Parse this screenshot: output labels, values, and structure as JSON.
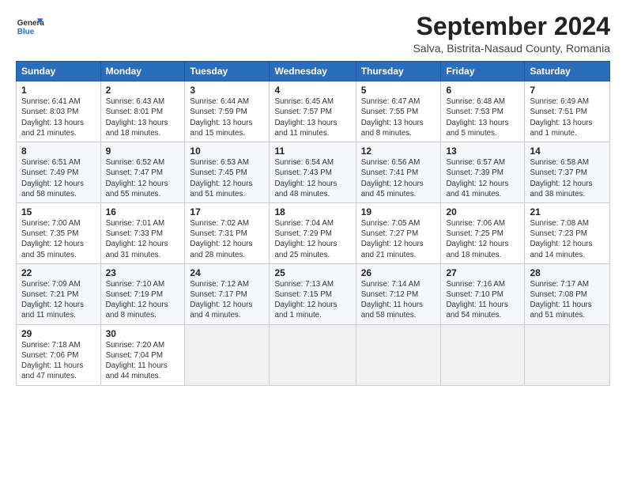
{
  "header": {
    "logo_line1": "General",
    "logo_line2": "Blue",
    "month_title": "September 2024",
    "subtitle": "Salva, Bistrita-Nasaud County, Romania"
  },
  "weekdays": [
    "Sunday",
    "Monday",
    "Tuesday",
    "Wednesday",
    "Thursday",
    "Friday",
    "Saturday"
  ],
  "weeks": [
    [
      {
        "day": "1",
        "info": "Sunrise: 6:41 AM\nSunset: 8:03 PM\nDaylight: 13 hours\nand 21 minutes."
      },
      {
        "day": "2",
        "info": "Sunrise: 6:43 AM\nSunset: 8:01 PM\nDaylight: 13 hours\nand 18 minutes."
      },
      {
        "day": "3",
        "info": "Sunrise: 6:44 AM\nSunset: 7:59 PM\nDaylight: 13 hours\nand 15 minutes."
      },
      {
        "day": "4",
        "info": "Sunrise: 6:45 AM\nSunset: 7:57 PM\nDaylight: 13 hours\nand 11 minutes."
      },
      {
        "day": "5",
        "info": "Sunrise: 6:47 AM\nSunset: 7:55 PM\nDaylight: 13 hours\nand 8 minutes."
      },
      {
        "day": "6",
        "info": "Sunrise: 6:48 AM\nSunset: 7:53 PM\nDaylight: 13 hours\nand 5 minutes."
      },
      {
        "day": "7",
        "info": "Sunrise: 6:49 AM\nSunset: 7:51 PM\nDaylight: 13 hours\nand 1 minute."
      }
    ],
    [
      {
        "day": "8",
        "info": "Sunrise: 6:51 AM\nSunset: 7:49 PM\nDaylight: 12 hours\nand 58 minutes."
      },
      {
        "day": "9",
        "info": "Sunrise: 6:52 AM\nSunset: 7:47 PM\nDaylight: 12 hours\nand 55 minutes."
      },
      {
        "day": "10",
        "info": "Sunrise: 6:53 AM\nSunset: 7:45 PM\nDaylight: 12 hours\nand 51 minutes."
      },
      {
        "day": "11",
        "info": "Sunrise: 6:54 AM\nSunset: 7:43 PM\nDaylight: 12 hours\nand 48 minutes."
      },
      {
        "day": "12",
        "info": "Sunrise: 6:56 AM\nSunset: 7:41 PM\nDaylight: 12 hours\nand 45 minutes."
      },
      {
        "day": "13",
        "info": "Sunrise: 6:57 AM\nSunset: 7:39 PM\nDaylight: 12 hours\nand 41 minutes."
      },
      {
        "day": "14",
        "info": "Sunrise: 6:58 AM\nSunset: 7:37 PM\nDaylight: 12 hours\nand 38 minutes."
      }
    ],
    [
      {
        "day": "15",
        "info": "Sunrise: 7:00 AM\nSunset: 7:35 PM\nDaylight: 12 hours\nand 35 minutes."
      },
      {
        "day": "16",
        "info": "Sunrise: 7:01 AM\nSunset: 7:33 PM\nDaylight: 12 hours\nand 31 minutes."
      },
      {
        "day": "17",
        "info": "Sunrise: 7:02 AM\nSunset: 7:31 PM\nDaylight: 12 hours\nand 28 minutes."
      },
      {
        "day": "18",
        "info": "Sunrise: 7:04 AM\nSunset: 7:29 PM\nDaylight: 12 hours\nand 25 minutes."
      },
      {
        "day": "19",
        "info": "Sunrise: 7:05 AM\nSunset: 7:27 PM\nDaylight: 12 hours\nand 21 minutes."
      },
      {
        "day": "20",
        "info": "Sunrise: 7:06 AM\nSunset: 7:25 PM\nDaylight: 12 hours\nand 18 minutes."
      },
      {
        "day": "21",
        "info": "Sunrise: 7:08 AM\nSunset: 7:23 PM\nDaylight: 12 hours\nand 14 minutes."
      }
    ],
    [
      {
        "day": "22",
        "info": "Sunrise: 7:09 AM\nSunset: 7:21 PM\nDaylight: 12 hours\nand 11 minutes."
      },
      {
        "day": "23",
        "info": "Sunrise: 7:10 AM\nSunset: 7:19 PM\nDaylight: 12 hours\nand 8 minutes."
      },
      {
        "day": "24",
        "info": "Sunrise: 7:12 AM\nSunset: 7:17 PM\nDaylight: 12 hours\nand 4 minutes."
      },
      {
        "day": "25",
        "info": "Sunrise: 7:13 AM\nSunset: 7:15 PM\nDaylight: 12 hours\nand 1 minute."
      },
      {
        "day": "26",
        "info": "Sunrise: 7:14 AM\nSunset: 7:12 PM\nDaylight: 11 hours\nand 58 minutes."
      },
      {
        "day": "27",
        "info": "Sunrise: 7:16 AM\nSunset: 7:10 PM\nDaylight: 11 hours\nand 54 minutes."
      },
      {
        "day": "28",
        "info": "Sunrise: 7:17 AM\nSunset: 7:08 PM\nDaylight: 11 hours\nand 51 minutes."
      }
    ],
    [
      {
        "day": "29",
        "info": "Sunrise: 7:18 AM\nSunset: 7:06 PM\nDaylight: 11 hours\nand 47 minutes."
      },
      {
        "day": "30",
        "info": "Sunrise: 7:20 AM\nSunset: 7:04 PM\nDaylight: 11 hours\nand 44 minutes."
      },
      {
        "day": "",
        "info": ""
      },
      {
        "day": "",
        "info": ""
      },
      {
        "day": "",
        "info": ""
      },
      {
        "day": "",
        "info": ""
      },
      {
        "day": "",
        "info": ""
      }
    ]
  ]
}
